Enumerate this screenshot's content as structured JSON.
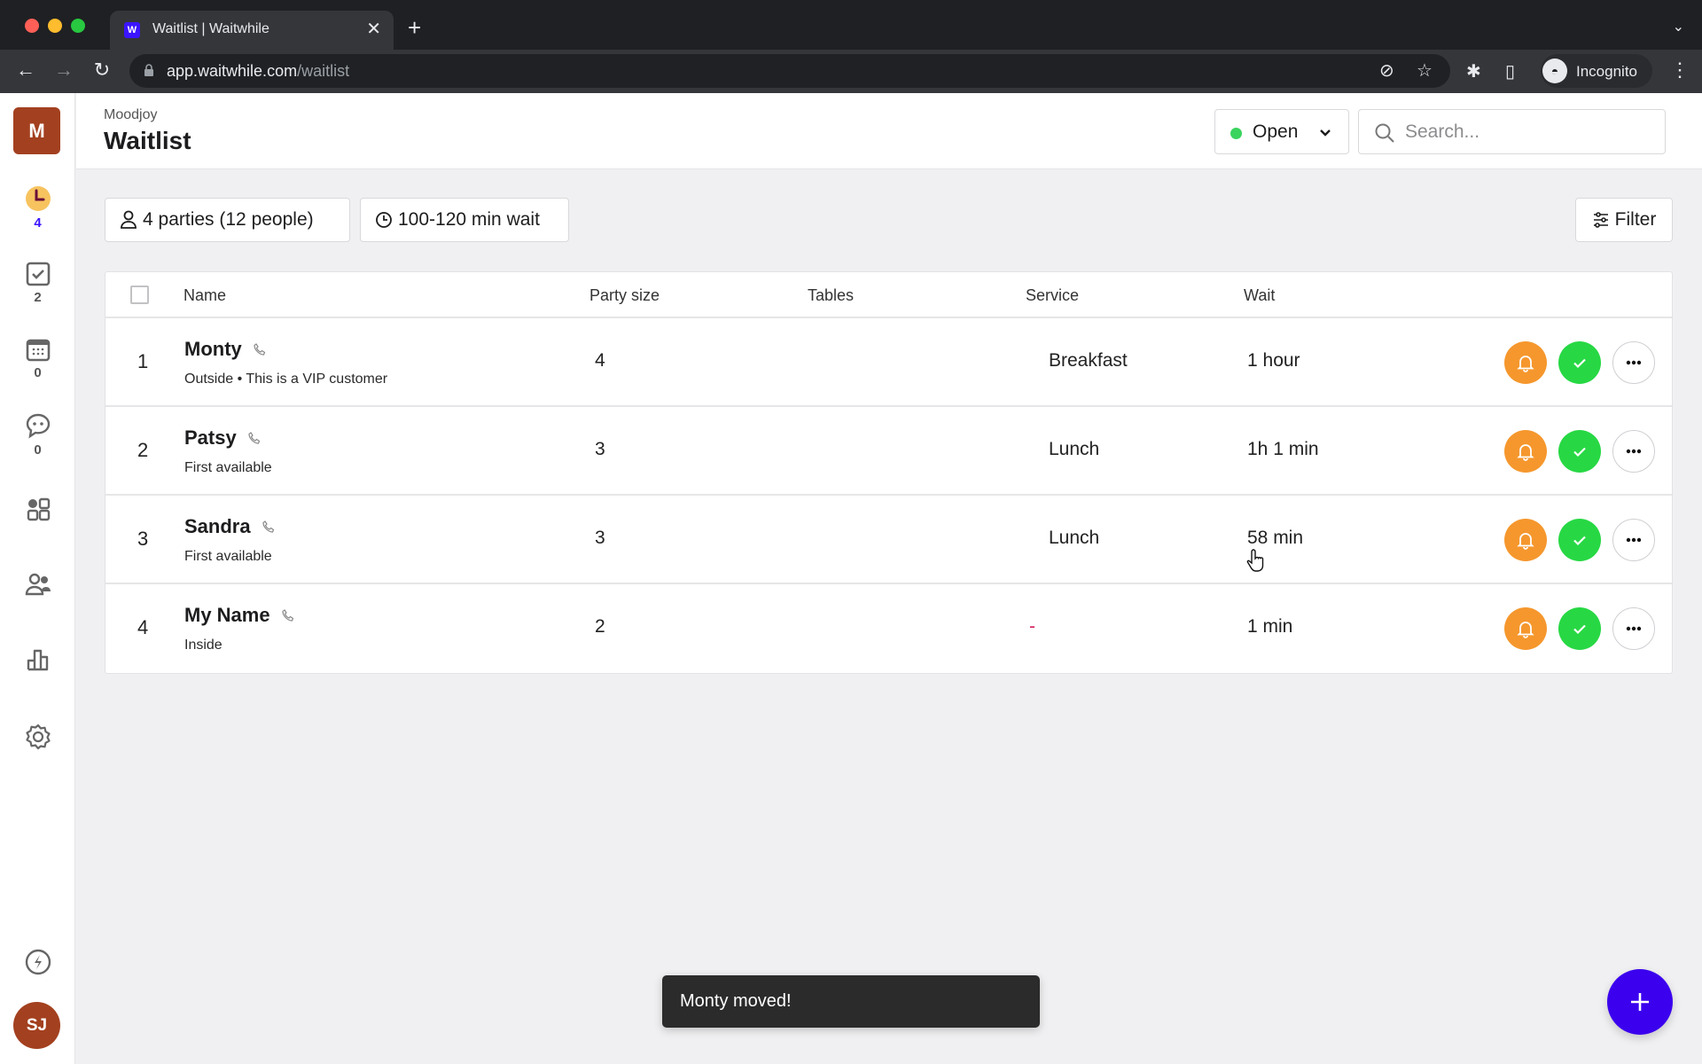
{
  "browser": {
    "tab_title": "Waitlist | Waitwhile",
    "url_host": "app.waitwhile.com",
    "url_path": "/waitlist",
    "profile_label": "Incognito"
  },
  "sidebar": {
    "org_initial": "M",
    "items": [
      {
        "name": "waitlist",
        "icon": "clock-icon",
        "count": "4",
        "active": true
      },
      {
        "name": "served",
        "icon": "checkbox-icon",
        "count": "2"
      },
      {
        "name": "bookings",
        "icon": "calendar-icon",
        "count": "0"
      },
      {
        "name": "messages",
        "icon": "chat-icon",
        "count": "0"
      },
      {
        "name": "apps",
        "icon": "grid-icon"
      },
      {
        "name": "customers",
        "icon": "users-icon"
      },
      {
        "name": "analytics",
        "icon": "bar-chart-icon"
      },
      {
        "name": "settings",
        "icon": "gear-icon"
      },
      {
        "name": "whats-new",
        "icon": "lightning-icon"
      }
    ],
    "user_initials": "SJ"
  },
  "header": {
    "org_name": "Moodjoy",
    "title": "Waitlist",
    "status": {
      "label": "Open",
      "color": "#3ad45e"
    },
    "search": {
      "placeholder": "Search...",
      "value": ""
    }
  },
  "summary": {
    "parties": "4 parties (12 people)",
    "wait": "100-120 min wait",
    "filter_label": "Filter"
  },
  "table": {
    "columns": [
      "Name",
      "Party size",
      "Tables",
      "Service",
      "Wait"
    ],
    "rows": [
      {
        "position": "1",
        "name": "Monty",
        "sub": "Outside  • This is a VIP customer",
        "party_size": "4",
        "tables": "",
        "service": "Breakfast",
        "wait": "1 hour"
      },
      {
        "position": "2",
        "name": "Patsy",
        "sub": "First available",
        "party_size": "3",
        "tables": "",
        "service": "Lunch",
        "wait": "1h 1 min"
      },
      {
        "position": "3",
        "name": "Sandra",
        "sub": "First available",
        "party_size": "3",
        "tables": "",
        "service": "Lunch",
        "wait": "58 min"
      },
      {
        "position": "4",
        "name": "My Name",
        "sub": "Inside",
        "party_size": "2",
        "tables": "",
        "service": "-",
        "wait": "1 min"
      }
    ]
  },
  "toast": {
    "message": "Monty moved!"
  },
  "colors": {
    "brand": "#3b00ee",
    "notify": "#f5972d",
    "seat": "#27d844",
    "org_badge": "#a3401f"
  }
}
